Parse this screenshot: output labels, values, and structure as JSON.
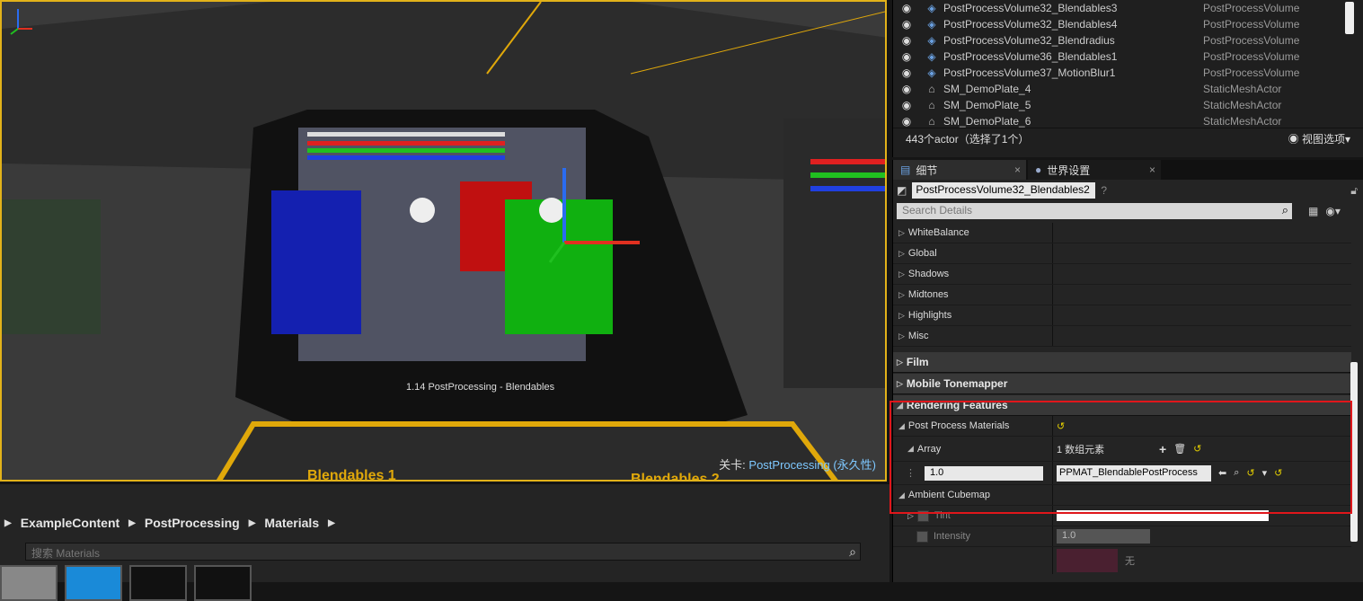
{
  "viewport": {
    "level_prefix": "关卡:",
    "level_name": "PostProcessing (永久性)",
    "scene_text": "1.14 PostProcessing - Blendables",
    "floor_text_1": "Blendables 1",
    "floor_text_2": "Blendables 2"
  },
  "outliner": {
    "rows": [
      {
        "name": "PostProcessVolume32_Blendables3",
        "type": "PostProcessVolume"
      },
      {
        "name": "PostProcessVolume32_Blendables4",
        "type": "PostProcessVolume"
      },
      {
        "name": "PostProcessVolume32_Blendradius",
        "type": "PostProcessVolume"
      },
      {
        "name": "PostProcessVolume36_Blendables1",
        "type": "PostProcessVolume"
      },
      {
        "name": "PostProcessVolume37_MotionBlur1",
        "type": "PostProcessVolume"
      },
      {
        "name": "SM_DemoPlate_4",
        "type": "StaticMeshActor"
      },
      {
        "name": "SM_DemoPlate_5",
        "type": "StaticMeshActor"
      },
      {
        "name": "SM_DemoPlate_6",
        "type": "StaticMeshActor"
      }
    ],
    "count_text": "443个actor（选择了1个）",
    "view_options": "视图选项▾"
  },
  "details": {
    "tabs": [
      {
        "label": "细节"
      },
      {
        "label": "世界设置"
      }
    ],
    "object_name": "PostProcessVolume32_Blendables2",
    "search_placeholder": "Search Details",
    "groups": [
      "WhiteBalance",
      "Global",
      "Shadows",
      "Midtones",
      "Highlights",
      "Misc"
    ],
    "categories": {
      "film": "Film",
      "mobile": "Mobile Tonemapper",
      "rendering": "Rendering Features"
    },
    "ppm_label": "Post Process Materials",
    "array_label": "Array",
    "array_count": "1 数组元素",
    "element_value": "1.0",
    "element_asset": "PPMAT_BlendablePostProcess",
    "ambient_label": "Ambient Cubemap",
    "tint_label": "Tint",
    "intensity_label": "Intensity",
    "intensity_value": "1.0",
    "none_label": "无"
  },
  "content_browser": {
    "breadcrumbs": [
      "ExampleContent",
      "PostProcessing",
      "Materials"
    ],
    "search_placeholder": "搜索 Materials"
  },
  "colors": {
    "selection_border": "#e0161b",
    "viewport_border": "#e2b21a"
  }
}
